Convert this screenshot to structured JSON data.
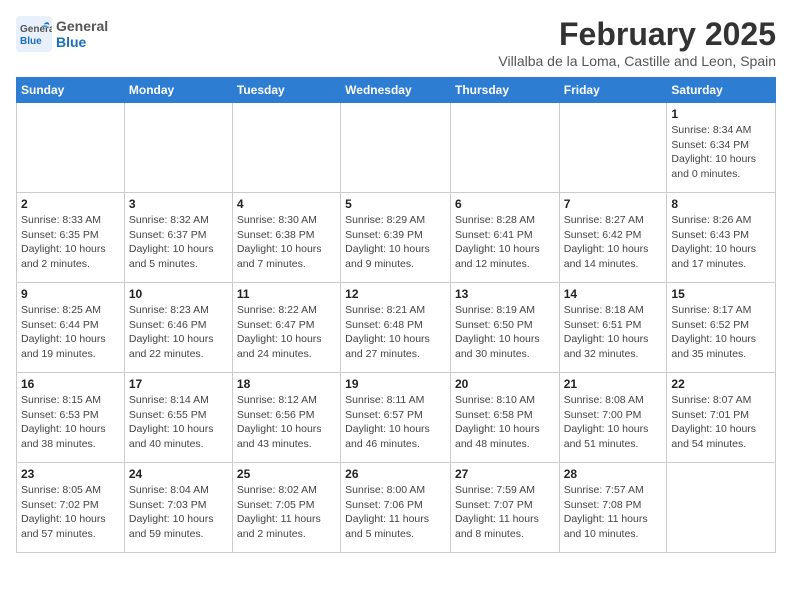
{
  "header": {
    "logo_general": "General",
    "logo_blue": "Blue",
    "month_title": "February 2025",
    "subtitle": "Villalba de la Loma, Castille and Leon, Spain"
  },
  "weekdays": [
    "Sunday",
    "Monday",
    "Tuesday",
    "Wednesday",
    "Thursday",
    "Friday",
    "Saturday"
  ],
  "weeks": [
    [
      {
        "day": "",
        "info": ""
      },
      {
        "day": "",
        "info": ""
      },
      {
        "day": "",
        "info": ""
      },
      {
        "day": "",
        "info": ""
      },
      {
        "day": "",
        "info": ""
      },
      {
        "day": "",
        "info": ""
      },
      {
        "day": "1",
        "info": "Sunrise: 8:34 AM\nSunset: 6:34 PM\nDaylight: 10 hours and 0 minutes."
      }
    ],
    [
      {
        "day": "2",
        "info": "Sunrise: 8:33 AM\nSunset: 6:35 PM\nDaylight: 10 hours and 2 minutes."
      },
      {
        "day": "3",
        "info": "Sunrise: 8:32 AM\nSunset: 6:37 PM\nDaylight: 10 hours and 5 minutes."
      },
      {
        "day": "4",
        "info": "Sunrise: 8:30 AM\nSunset: 6:38 PM\nDaylight: 10 hours and 7 minutes."
      },
      {
        "day": "5",
        "info": "Sunrise: 8:29 AM\nSunset: 6:39 PM\nDaylight: 10 hours and 9 minutes."
      },
      {
        "day": "6",
        "info": "Sunrise: 8:28 AM\nSunset: 6:41 PM\nDaylight: 10 hours and 12 minutes."
      },
      {
        "day": "7",
        "info": "Sunrise: 8:27 AM\nSunset: 6:42 PM\nDaylight: 10 hours and 14 minutes."
      },
      {
        "day": "8",
        "info": "Sunrise: 8:26 AM\nSunset: 6:43 PM\nDaylight: 10 hours and 17 minutes."
      }
    ],
    [
      {
        "day": "9",
        "info": "Sunrise: 8:25 AM\nSunset: 6:44 PM\nDaylight: 10 hours and 19 minutes."
      },
      {
        "day": "10",
        "info": "Sunrise: 8:23 AM\nSunset: 6:46 PM\nDaylight: 10 hours and 22 minutes."
      },
      {
        "day": "11",
        "info": "Sunrise: 8:22 AM\nSunset: 6:47 PM\nDaylight: 10 hours and 24 minutes."
      },
      {
        "day": "12",
        "info": "Sunrise: 8:21 AM\nSunset: 6:48 PM\nDaylight: 10 hours and 27 minutes."
      },
      {
        "day": "13",
        "info": "Sunrise: 8:19 AM\nSunset: 6:50 PM\nDaylight: 10 hours and 30 minutes."
      },
      {
        "day": "14",
        "info": "Sunrise: 8:18 AM\nSunset: 6:51 PM\nDaylight: 10 hours and 32 minutes."
      },
      {
        "day": "15",
        "info": "Sunrise: 8:17 AM\nSunset: 6:52 PM\nDaylight: 10 hours and 35 minutes."
      }
    ],
    [
      {
        "day": "16",
        "info": "Sunrise: 8:15 AM\nSunset: 6:53 PM\nDaylight: 10 hours and 38 minutes."
      },
      {
        "day": "17",
        "info": "Sunrise: 8:14 AM\nSunset: 6:55 PM\nDaylight: 10 hours and 40 minutes."
      },
      {
        "day": "18",
        "info": "Sunrise: 8:12 AM\nSunset: 6:56 PM\nDaylight: 10 hours and 43 minutes."
      },
      {
        "day": "19",
        "info": "Sunrise: 8:11 AM\nSunset: 6:57 PM\nDaylight: 10 hours and 46 minutes."
      },
      {
        "day": "20",
        "info": "Sunrise: 8:10 AM\nSunset: 6:58 PM\nDaylight: 10 hours and 48 minutes."
      },
      {
        "day": "21",
        "info": "Sunrise: 8:08 AM\nSunset: 7:00 PM\nDaylight: 10 hours and 51 minutes."
      },
      {
        "day": "22",
        "info": "Sunrise: 8:07 AM\nSunset: 7:01 PM\nDaylight: 10 hours and 54 minutes."
      }
    ],
    [
      {
        "day": "23",
        "info": "Sunrise: 8:05 AM\nSunset: 7:02 PM\nDaylight: 10 hours and 57 minutes."
      },
      {
        "day": "24",
        "info": "Sunrise: 8:04 AM\nSunset: 7:03 PM\nDaylight: 10 hours and 59 minutes."
      },
      {
        "day": "25",
        "info": "Sunrise: 8:02 AM\nSunset: 7:05 PM\nDaylight: 11 hours and 2 minutes."
      },
      {
        "day": "26",
        "info": "Sunrise: 8:00 AM\nSunset: 7:06 PM\nDaylight: 11 hours and 5 minutes."
      },
      {
        "day": "27",
        "info": "Sunrise: 7:59 AM\nSunset: 7:07 PM\nDaylight: 11 hours and 8 minutes."
      },
      {
        "day": "28",
        "info": "Sunrise: 7:57 AM\nSunset: 7:08 PM\nDaylight: 11 hours and 10 minutes."
      },
      {
        "day": "",
        "info": ""
      }
    ]
  ]
}
